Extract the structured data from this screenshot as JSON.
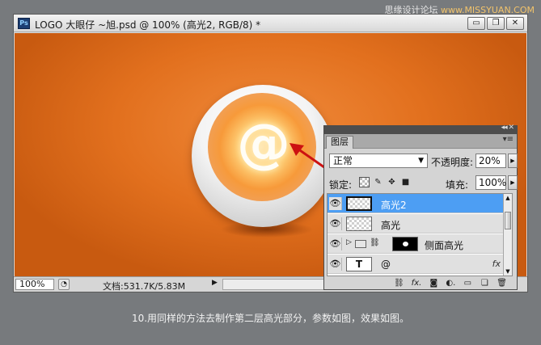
{
  "watermark": {
    "cn": "思缘设计论坛",
    "url": "www.MISSYUAN.COM"
  },
  "window": {
    "title": "LOGO 大眼仔 ~旭.psd @ 100% (高光2, RGB/8) *",
    "ps_label": "Ps",
    "buttons": {
      "minimize": "▭",
      "restore": "❐",
      "close": "✕"
    }
  },
  "canvas": {
    "logo_glyph": "@"
  },
  "statusbar": {
    "zoom": "100%",
    "doc_info": "文档:531.7K/5.83M",
    "arrow": "▶"
  },
  "layers_panel": {
    "tab": "图层",
    "blend_mode": "正常",
    "opacity_label": "不透明度:",
    "opacity": "20%",
    "lock_label": "锁定:",
    "fill_label": "填充:",
    "fill": "100%",
    "layers": [
      {
        "name": "高光2",
        "selected": true
      },
      {
        "name": "高光",
        "selected": false
      },
      {
        "name": "侧面高光",
        "selected": false
      },
      {
        "name": "@",
        "selected": false,
        "fx": "fx"
      }
    ]
  },
  "caption": "10.用同样的方法去制作第二层高光部分，参数如图，效果如图。",
  "colors": {
    "canvas": "#e2701e",
    "selected_layer": "#4d9ef3",
    "arrow": "#cc1111"
  }
}
